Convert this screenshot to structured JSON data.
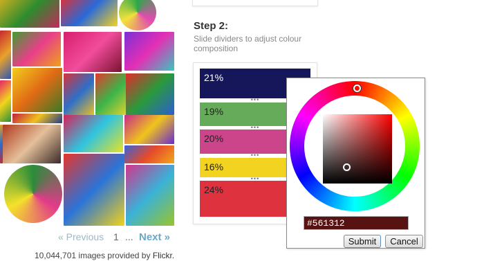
{
  "gallery": {
    "pagination": {
      "previous_label": "« Previous",
      "current_page": "1",
      "ellipsis": "...",
      "next_label": "Next »"
    },
    "credit": {
      "count": "10,044,701",
      "text": "images provided by",
      "source": "Flickr."
    },
    "tiles": [
      {
        "name": "painted-wall-thumbnail",
        "colors": [
          "#d6b21f",
          "#2c8c2e",
          "#c22a5b"
        ]
      },
      {
        "name": "gumballs-thumbnail",
        "colors": [
          "#e52c2c",
          "#2a6ad8",
          "#f5d321"
        ]
      },
      {
        "name": "color-wheel-thumbnail",
        "colors": [
          "#2aa84a",
          "#e24bb0",
          "#f2e23a"
        ]
      },
      {
        "name": "yarn-thumbnail",
        "colors": [
          "#c8282c",
          "#e8a22c",
          "#2e55b8"
        ]
      },
      {
        "name": "green-shapes-thumbnail",
        "colors": [
          "#3f9e2f",
          "#e83f8a",
          "#f0a21a"
        ]
      },
      {
        "name": "pink-flower-thumbnail",
        "colors": [
          "#d61f6b",
          "#f24c9c",
          "#7a1230"
        ]
      },
      {
        "name": "neon-plants-thumbnail",
        "colors": [
          "#7a2fd6",
          "#e42fb5",
          "#38c7c0"
        ]
      },
      {
        "name": "sunflower-thumbnail",
        "colors": [
          "#f2cc1e",
          "#e06a15",
          "#3a7a26"
        ]
      },
      {
        "name": "tulips-thumbnail",
        "colors": [
          "#e8226a",
          "#f2d41b",
          "#2d8e3a"
        ]
      },
      {
        "name": "fabric-thumbnail",
        "colors": [
          "#d8323a",
          "#2e6fc7",
          "#f0c21f"
        ]
      },
      {
        "name": "swirl-thumbnail",
        "colors": [
          "#e33a2a",
          "#3bb54a",
          "#f0d52c"
        ]
      },
      {
        "name": "rainbow-stripes-thumbnail",
        "colors": [
          "#e32a2a",
          "#2a9a3c",
          "#2d5ed0"
        ]
      },
      {
        "name": "manifest-poster-thumbnail",
        "colors": [
          "#c11e3a",
          "#f0c020",
          "#203a8c"
        ]
      },
      {
        "name": "glitch-thumbnail",
        "colors": [
          "#b02a8c",
          "#e23c3c",
          "#2a8ad8"
        ]
      },
      {
        "name": "child-thumbnail",
        "colors": [
          "#b03a1e",
          "#e4c09a",
          "#3a2a2a"
        ]
      },
      {
        "name": "umbrellas-thumbnail",
        "colors": [
          "#d6225a",
          "#2fc4e0",
          "#e8e226"
        ]
      },
      {
        "name": "daisies-thumbnail",
        "colors": [
          "#c72a8c",
          "#f0c41c",
          "#6a2ad0"
        ]
      },
      {
        "name": "mural-thumbnail",
        "colors": [
          "#3a62d6",
          "#e64a2a",
          "#f2a81c"
        ]
      },
      {
        "name": "palette-wheel-thumbnail",
        "colors": [
          "#2a8c3a",
          "#e23a8a",
          "#f5e22a"
        ]
      },
      {
        "name": "balls-thumbnail",
        "colors": [
          "#e8342a",
          "#2a74d8",
          "#f2d21a"
        ]
      },
      {
        "name": "painted-eggs-thumbnail",
        "colors": [
          "#d4348c",
          "#3ab2d8",
          "#9ac42a"
        ]
      },
      {
        "name": "partial-left-thumbnail",
        "colors": [
          "#e2a21c",
          "#2a6ad0",
          "#c8282c"
        ]
      }
    ]
  },
  "step": {
    "title": "Step 2:",
    "subtitle": "Slide dividers to adjust colour composition",
    "divider_glyph": "•••",
    "bars": [
      {
        "name": "color-bar-navy",
        "percent": "21%",
        "color": "#16175a",
        "text_color": "#ffffff"
      },
      {
        "name": "color-bar-green",
        "percent": "19%",
        "color": "#66ab5a",
        "text_color": "#222222"
      },
      {
        "name": "color-bar-magenta",
        "percent": "20%",
        "color": "#cc4489",
        "text_color": "#222222"
      },
      {
        "name": "color-bar-yellow",
        "percent": "16%",
        "color": "#f2d31f",
        "text_color": "#222222"
      },
      {
        "name": "color-bar-red",
        "percent": "24%",
        "color": "#de333e",
        "text_color": "#222222"
      }
    ]
  },
  "picker": {
    "hex_value": "#561312",
    "submit_label": "Submit",
    "cancel_label": "Cancel"
  }
}
